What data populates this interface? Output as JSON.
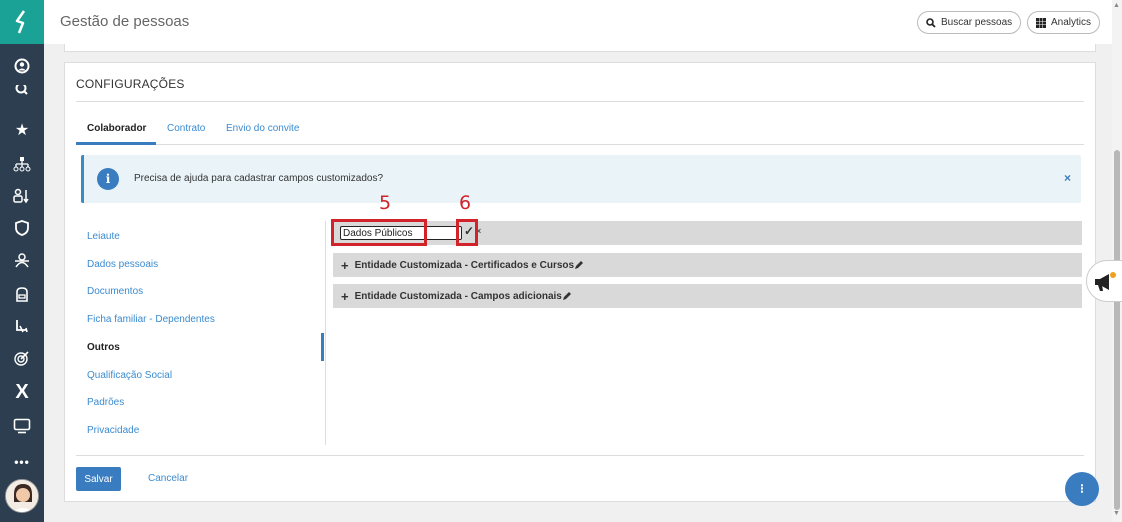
{
  "header": {
    "title": "Gestão de pessoas",
    "search_button": "Buscar pessoas",
    "analytics_button": "Analytics"
  },
  "panel": {
    "title": "CONFIGURAÇÕES",
    "tabs": [
      "Colaborador",
      "Contrato",
      "Envio do convite"
    ]
  },
  "alert": {
    "message": "Precisa de ajuda para cadastrar campos customizados?",
    "icon": "i",
    "close": "×"
  },
  "sidemenu": {
    "items": [
      "Leiaute",
      "Dados pessoais",
      "Documentos",
      "Ficha familiar - Dependentes",
      "Outros",
      "Qualificação Social",
      "Padrões",
      "Privacidade"
    ]
  },
  "sections": {
    "editing_value": "Dados Públicos",
    "items": [
      "Entidade Customizada - Certificados e Cursos",
      "Entidade Customizada - Campos adicionais"
    ]
  },
  "annotations": {
    "label_5": "5",
    "label_6": "6"
  },
  "footer": {
    "save_label": "Salvar",
    "cancel_label": "Cancelar"
  },
  "fab_label": "⁝",
  "colors": {
    "accent": "#3a7cc0",
    "logo_bg": "#1aa296",
    "nav_bg": "#2c3e50",
    "annotation": "#d2232a"
  }
}
